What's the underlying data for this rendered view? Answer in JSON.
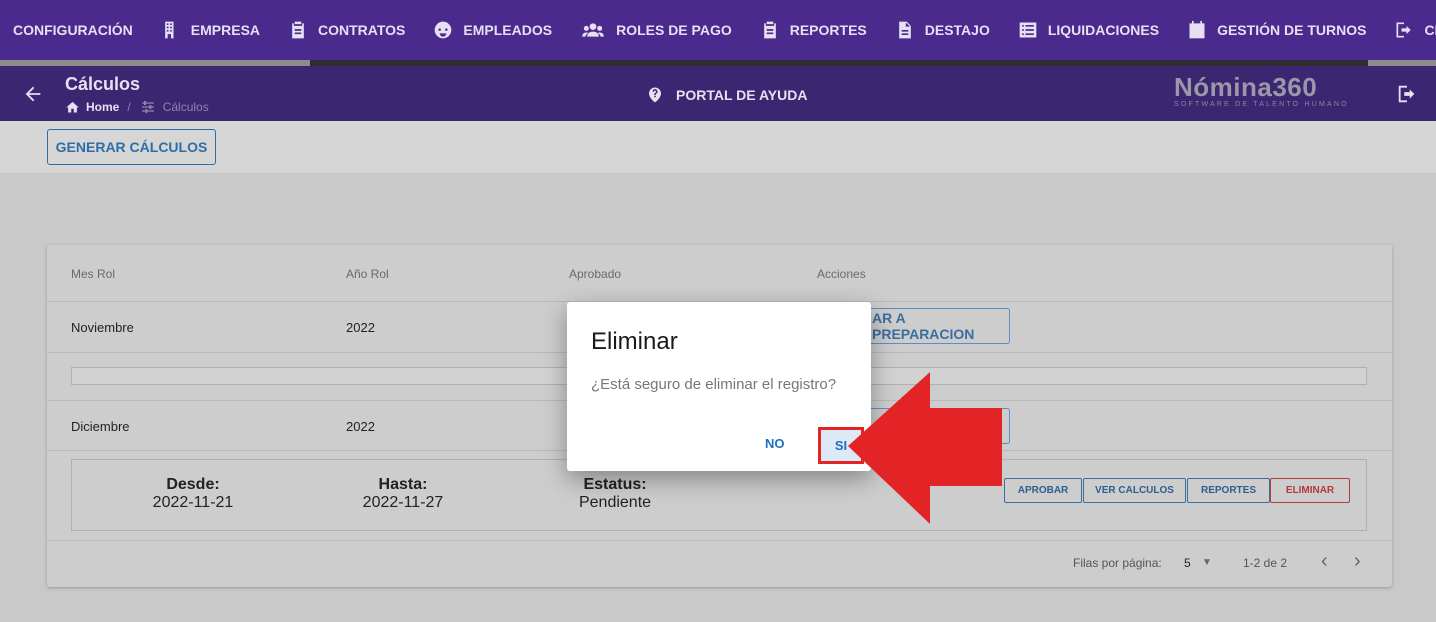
{
  "nav": {
    "items": [
      {
        "label": "CONFIGURACIÓN",
        "icon": "none"
      },
      {
        "label": "EMPRESA",
        "icon": "building-icon"
      },
      {
        "label": "CONTRATOS",
        "icon": "clipboard-icon"
      },
      {
        "label": "EMPLEADOS",
        "icon": "face-icon"
      },
      {
        "label": "ROLES DE PAGO",
        "icon": "group-icon"
      },
      {
        "label": "REPORTES",
        "icon": "clipboard-icon"
      },
      {
        "label": "DESTAJO",
        "icon": "document-icon"
      },
      {
        "label": "LIQUIDACIONES",
        "icon": "list-icon"
      },
      {
        "label": "GESTIÓN DE TURNOS",
        "icon": "calendar-icon"
      },
      {
        "label": "CERRA",
        "icon": "logout-icon"
      }
    ]
  },
  "header": {
    "title": "Cálculos",
    "breadcrumb_home": "Home",
    "breadcrumb_sep": "/",
    "breadcrumb_current": "Cálculos",
    "help_label": "PORTAL DE AYUDA",
    "logo_name": "Nómina360",
    "logo_tagline": "SOFTWARE DE TALENTO HUMANO"
  },
  "toolbar": {
    "generate_label": "GENERAR CÁLCULOS"
  },
  "table": {
    "headers": [
      "Mes Rol",
      "Año Rol",
      "Aprobado",
      "Acciones"
    ],
    "rows": [
      {
        "mes": "Noviembre",
        "anio": "2022",
        "action_label": "AR A PREPARACION"
      },
      {
        "mes": "Diciembre",
        "anio": "2022",
        "action_label": ""
      }
    ],
    "detail": {
      "desde_label": "Desde:",
      "desde_value": "2022-11-21",
      "hasta_label": "Hasta:",
      "hasta_value": "2022-11-27",
      "estatus_label": "Estatus:",
      "estatus_value": "Pendiente"
    },
    "detail_buttons": {
      "approve": "APROBAR",
      "view": "VER CALCULOS",
      "reports": "REPORTES",
      "delete": "ELIMINAR"
    },
    "footer": {
      "rows_per_page_label": "Filas por página:",
      "rows_per_page_value": "5",
      "range": "1-2 de 2"
    }
  },
  "dialog": {
    "title": "Eliminar",
    "message": "¿Está seguro de eliminar el registro?",
    "no_label": "NO",
    "yes_label": "SI"
  },
  "colors": {
    "nav_bg": "#4a2a8c",
    "header_bg": "#3b2672",
    "accent_blue": "#1e6fbf",
    "danger_red": "#e32427"
  }
}
